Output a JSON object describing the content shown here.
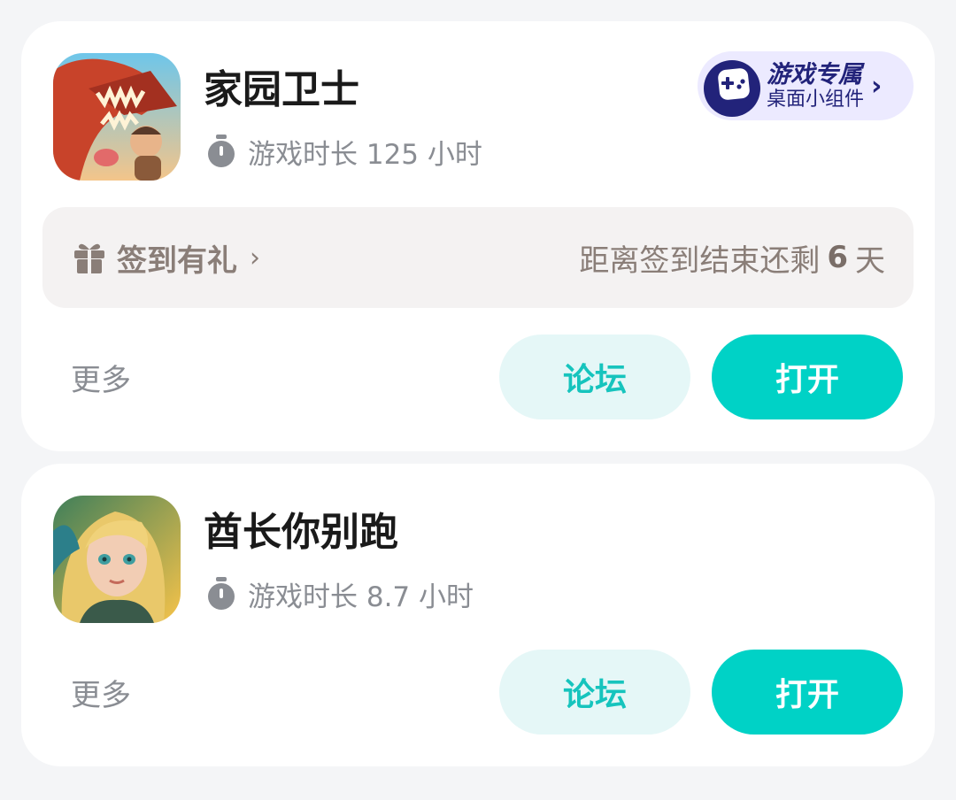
{
  "games": [
    {
      "name": "家园卫士",
      "playtime": "游戏时长 125 小时",
      "widget": {
        "title": "游戏专属",
        "subtitle": "桌面小组件"
      },
      "checkin": {
        "label": "签到有礼",
        "remaining_prefix": "距离签到结束还剩",
        "remaining_days": "6",
        "remaining_unit": "天"
      },
      "more_label": "更多",
      "forum_label": "论坛",
      "open_label": "打开",
      "icon": "dinosaur-game-icon"
    },
    {
      "name": "酋长你别跑",
      "playtime": "游戏时长 8.7 小时",
      "more_label": "更多",
      "forum_label": "论坛",
      "open_label": "打开",
      "icon": "blonde-girl-game-icon"
    }
  ],
  "colors": {
    "accent": "#00d2c6",
    "forum_bg": "#e5f7f7",
    "forum_text": "#16c4bd",
    "badge_bg": "#eceaff",
    "badge_text": "#22237a"
  }
}
